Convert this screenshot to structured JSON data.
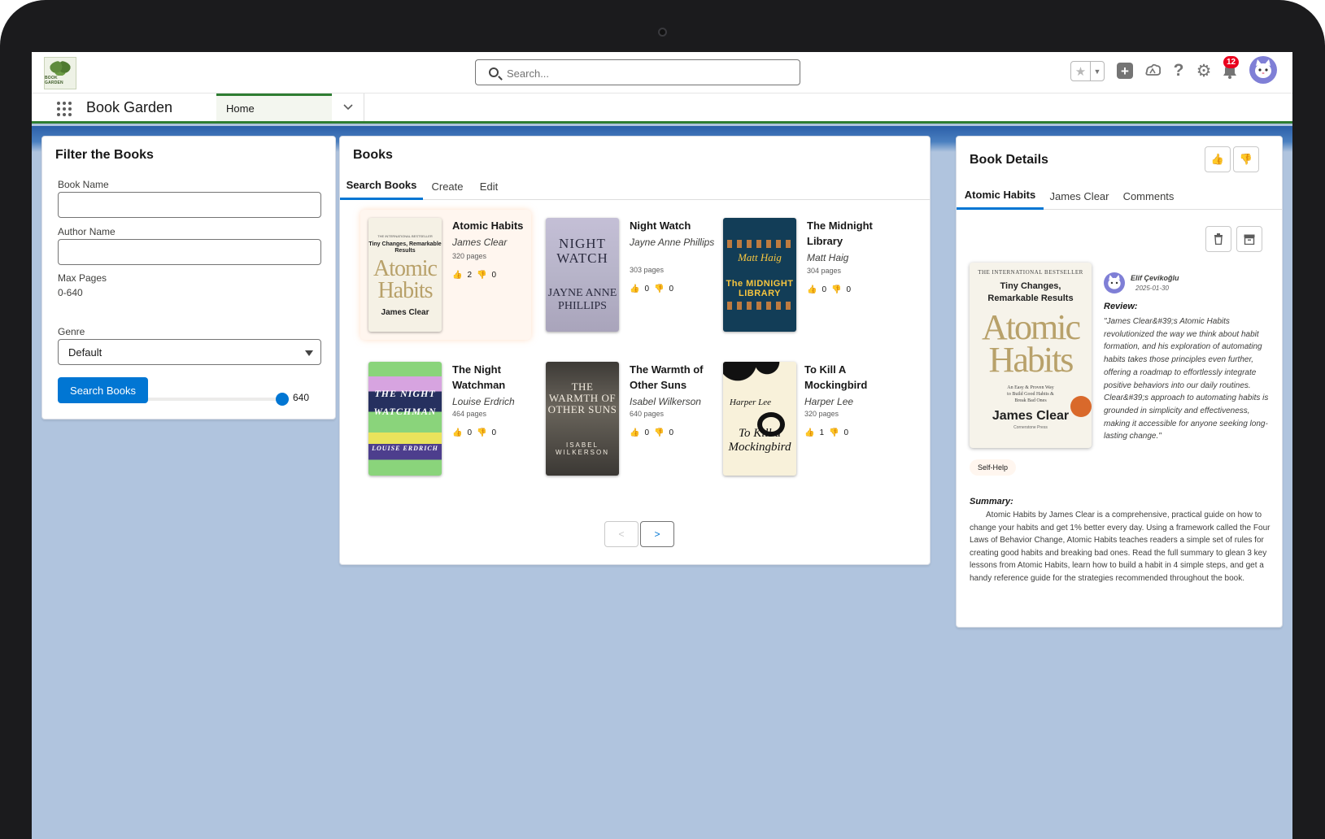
{
  "header": {
    "logo_text": "BOOK GARDEN",
    "search_placeholder": "Search...",
    "notification_count": "12"
  },
  "nav": {
    "app_name": "Book Garden",
    "tabs": [
      {
        "label": "Home"
      }
    ]
  },
  "filter": {
    "title": "Filter the Books",
    "book_name_label": "Book Name",
    "book_name_value": "",
    "author_name_label": "Author Name",
    "author_name_value": "",
    "max_pages_label": "Max Pages",
    "max_pages_range": "0-640",
    "max_pages_value": "640",
    "max_pages_fraction": 1.0,
    "genre_label": "Genre",
    "genre_value": "Default",
    "search_button": "Search Books"
  },
  "books": {
    "title": "Books",
    "tabs": [
      {
        "label": "Search Books",
        "active": true
      },
      {
        "label": "Create",
        "active": false
      },
      {
        "label": "Edit",
        "active": false
      }
    ],
    "items": [
      {
        "title": "Atomic Habits",
        "author": "James Clear",
        "pages": "320 pages",
        "likes": "2",
        "dislikes": "0",
        "selected": true
      },
      {
        "title": "Night Watch",
        "author": "Jayne Anne Phillips",
        "pages": "303 pages",
        "likes": "0",
        "dislikes": "0"
      },
      {
        "title": "The Midnight Library",
        "author": "Matt Haig",
        "pages": "304 pages",
        "likes": "0",
        "dislikes": "0"
      },
      {
        "title": "The Night Watchman",
        "author": "Louise Erdrich",
        "pages": "464 pages",
        "likes": "0",
        "dislikes": "0"
      },
      {
        "title": "The Warmth of Other Suns",
        "author": "Isabel Wilkerson",
        "pages": "640 pages",
        "likes": "0",
        "dislikes": "0"
      },
      {
        "title": "To Kill A Mockingbird",
        "author": "Harper Lee",
        "pages": "320 pages",
        "likes": "1",
        "dislikes": "0"
      }
    ],
    "covers": {
      "atomic_top": "THE INTERNATIONAL BESTSELLER",
      "atomic_sub": "Tiny Changes, Remarkable Results",
      "atomic_big": "Atomic Habits",
      "atomic_author": "James Clear",
      "night_watch_title": "NIGHT WATCH",
      "night_watch_author": "JAYNE ANNE PHILLIPS",
      "midnight_author": "Matt Haig",
      "midnight_title": "The MIDNIGHT LIBRARY",
      "watchman_title": "THE NIGHT WATCHMAN",
      "watchman_author": "LOUISE ERDRICH",
      "warmth_title": "THE WARMTH OF OTHER SUNS",
      "warmth_author": "ISABEL WILKERSON",
      "mock_author": "Harper Lee",
      "mock_title": "To Kill a Mockingbird"
    },
    "pager_prev": "<",
    "pager_next": ">"
  },
  "details": {
    "title": "Book Details",
    "tabs": [
      {
        "label": "Atomic Habits",
        "active": true
      },
      {
        "label": "James Clear",
        "active": false
      },
      {
        "label": "Comments",
        "active": false
      }
    ],
    "cover": {
      "top": "THE INTERNATIONAL BESTSELLER",
      "sub": "Tiny Changes, Remarkable Results",
      "big": "Atomic Habits",
      "tagline": "An Easy & Proven Way to Build Good Habits & Break Bad Ones",
      "author": "James Clear",
      "publisher": "Cornerstone Press"
    },
    "reviewer_name": "Elif Çevikoğlu",
    "review_date": "2025-01-30",
    "review_heading": "Review:",
    "review_text": "\"James Clear&#39;s Atomic Habits revolutionized the way we think about habit formation, and his exploration of automating habits takes those principles even further, offering a roadmap to effortlessly integrate positive behaviors into our daily routines. Clear&#39;s approach to automating habits is grounded in simplicity and effectiveness, making it accessible for anyone seeking long-lasting change.\"",
    "genre": "Self-Help",
    "summary_heading": "Summary:",
    "summary_text": "Atomic Habits by James Clear is a comprehensive, practical guide on how to change your habits and get 1% better every day. Using a framework called the Four Laws of Behavior Change, Atomic Habits teaches readers a simple set of rules for creating good habits and breaking bad ones. Read the full summary to glean 3 key lessons from Atomic Habits, learn how to build a habit in 4 simple steps, and get a handy reference guide for the strategies recommended throughout the book."
  },
  "colors": {
    "brand": "#0176d3",
    "nav_accent": "#2e7d32",
    "page_bg": "#b0c4de",
    "badge": "#ea001e"
  }
}
